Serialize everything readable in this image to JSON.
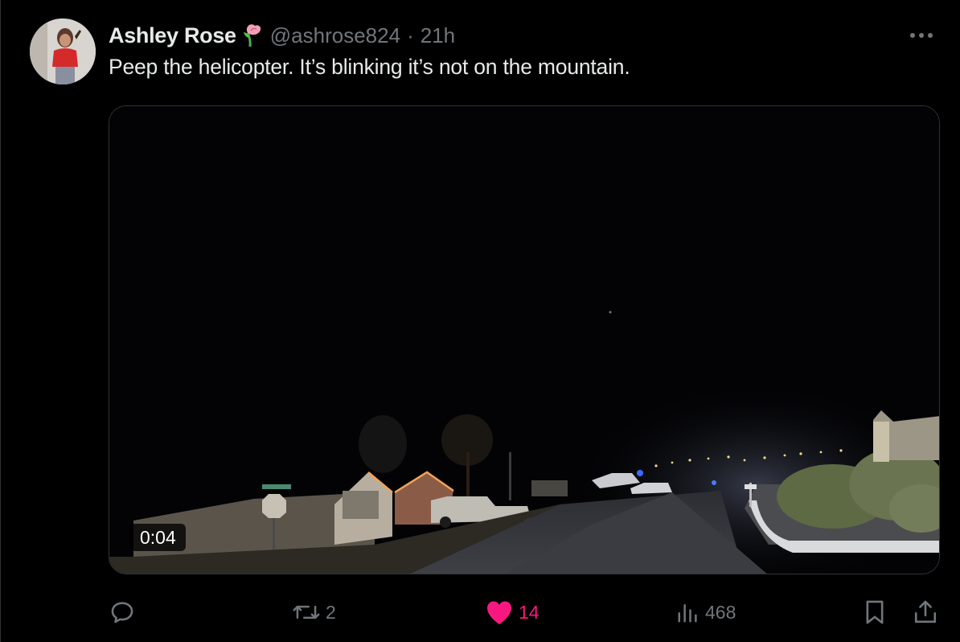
{
  "tweet": {
    "display_name": "Ashley Rose",
    "handle": "@ashrose824",
    "separator": "·",
    "time": "21h",
    "text": "Peep the helicopter. It’s blinking it’s not on the mountain.",
    "badge_icon": "rose-emoji"
  },
  "media": {
    "type": "video",
    "duration": "0:04"
  },
  "actions": {
    "reply": {
      "icon": "reply-icon",
      "count": ""
    },
    "repost": {
      "icon": "repost-icon",
      "count": "2"
    },
    "like": {
      "icon": "heart-icon",
      "count": "14",
      "liked": true
    },
    "views": {
      "icon": "views-icon",
      "count": "468"
    },
    "bookmark": {
      "icon": "bookmark-icon"
    },
    "share": {
      "icon": "share-icon"
    }
  },
  "colors": {
    "background": "#000000",
    "text_primary": "#e7e9ea",
    "text_secondary": "#71767b",
    "like_pink": "#f91880",
    "border": "#2f3336"
  }
}
